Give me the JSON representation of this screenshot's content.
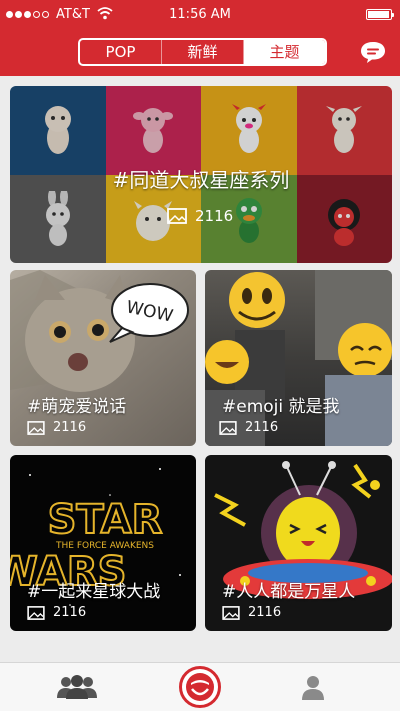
{
  "status_bar": {
    "carrier": "AT&T",
    "time": "11:56 AM"
  },
  "nav": {
    "tabs": [
      {
        "label": "POP",
        "active": false
      },
      {
        "label": "新鲜",
        "active": false
      },
      {
        "label": "主题",
        "active": true
      }
    ],
    "chat_icon": "chat-bubble-icon"
  },
  "featured": {
    "title": "#同道大叔星座系列",
    "count": "2116"
  },
  "cards": [
    {
      "title": "#萌宠爱说话",
      "count": "2116",
      "bubble_text": "WOW"
    },
    {
      "title": "#emoji 就是我",
      "count": "2116"
    },
    {
      "title": "#一起来星球大战",
      "count": "2116",
      "logo_line1": "STAR",
      "logo_subtitle": "THE FORCE AWAKENS",
      "logo_line2": "WARS"
    },
    {
      "title": "#人人都是万星人",
      "count": "2116"
    }
  ],
  "tabbar": {
    "left_icon": "people-icon",
    "center_icon": "camera-face-icon",
    "right_icon": "person-icon"
  },
  "colors": {
    "brand_red": "#d42a30"
  }
}
